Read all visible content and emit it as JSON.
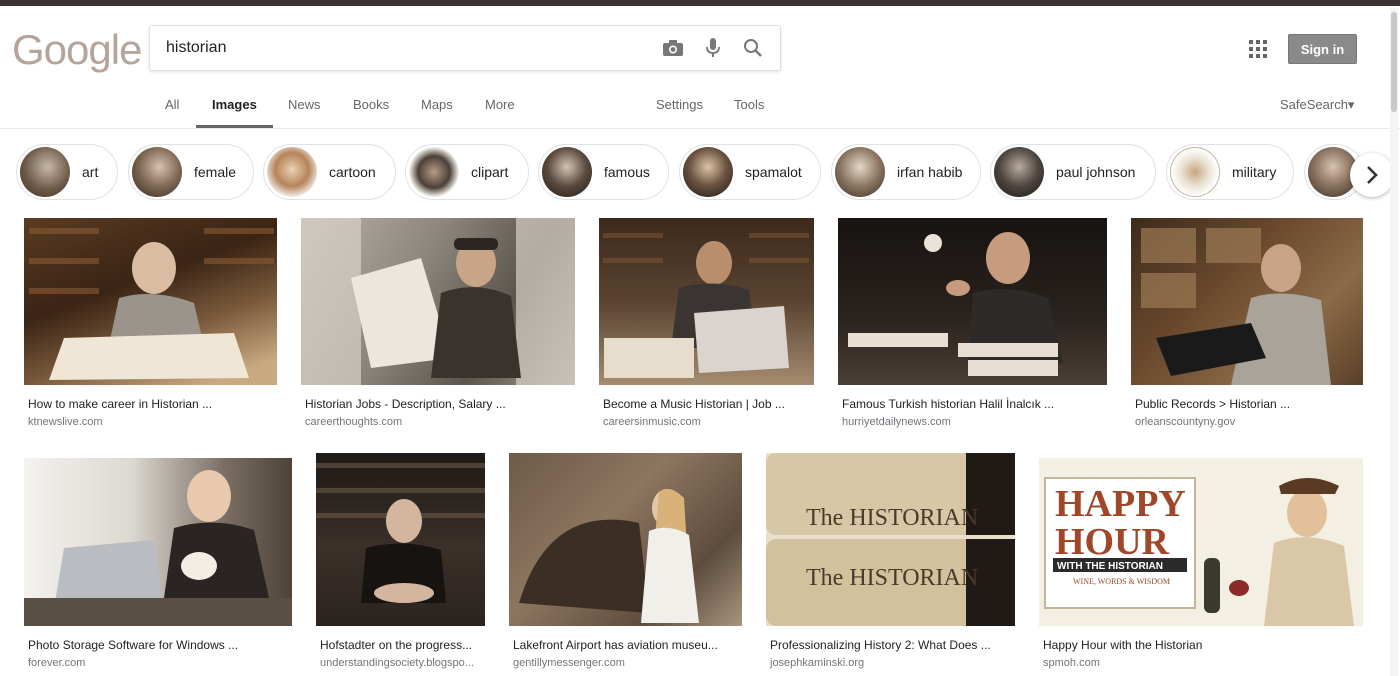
{
  "logo": {
    "text": "Google"
  },
  "search": {
    "value": "historian"
  },
  "icons": {
    "camera": "camera-icon",
    "mic": "microphone-icon",
    "search": "search-icon",
    "apps": "apps-grid-icon",
    "next": "chevron-right-icon"
  },
  "header": {
    "signin_label": "Sign in"
  },
  "tabs": [
    {
      "label": "All"
    },
    {
      "label": "Images"
    },
    {
      "label": "News"
    },
    {
      "label": "Books"
    },
    {
      "label": "Maps"
    },
    {
      "label": "More"
    },
    {
      "label": "Settings"
    },
    {
      "label": "Tools"
    }
  ],
  "safesearch": {
    "label": "SafeSearch▾"
  },
  "chips": [
    {
      "label": "art"
    },
    {
      "label": "female"
    },
    {
      "label": "cartoon"
    },
    {
      "label": "clipart"
    },
    {
      "label": "famous"
    },
    {
      "label": "spamalot"
    },
    {
      "label": "irfan habib"
    },
    {
      "label": "paul johnson"
    },
    {
      "label": "military"
    }
  ],
  "row1": [
    {
      "title": "How to make career in Historian ...",
      "domain": "ktnewslive.com"
    },
    {
      "title": "Historian Jobs - Description, Salary ...",
      "domain": "careerthoughts.com"
    },
    {
      "title": "Become a Music Historian | Job ...",
      "domain": "careersinmusic.com"
    },
    {
      "title": "Famous Turkish historian Halil İnalcık ...",
      "domain": "hurriyetdailynews.com"
    },
    {
      "title": "Public Records > Historian ...",
      "domain": "orleanscountyny.gov"
    }
  ],
  "row2": [
    {
      "title": "Photo Storage Software for Windows ...",
      "domain": "forever.com"
    },
    {
      "title": "Hofstadter on the progress...",
      "domain": "understandingsociety.blogspo..."
    },
    {
      "title": "Lakefront Airport has aviation museu...",
      "domain": "gentillymessenger.com"
    },
    {
      "title": "Professionalizing History 2: What Does ...",
      "domain": "josephkaminski.org"
    },
    {
      "title": "Happy Hour with the Historian",
      "domain": "spmoh.com"
    }
  ],
  "images": {
    "book_spine_1": "The HISTORIAN",
    "book_spine_2": "The HISTORIAN",
    "happy_hour_line1": "HAPPY",
    "happy_hour_line2": "HOUR",
    "happy_hour_line3": "WITH THE HISTORIAN",
    "happy_hour_line4": "WINE, WORDS & WISDOM"
  }
}
